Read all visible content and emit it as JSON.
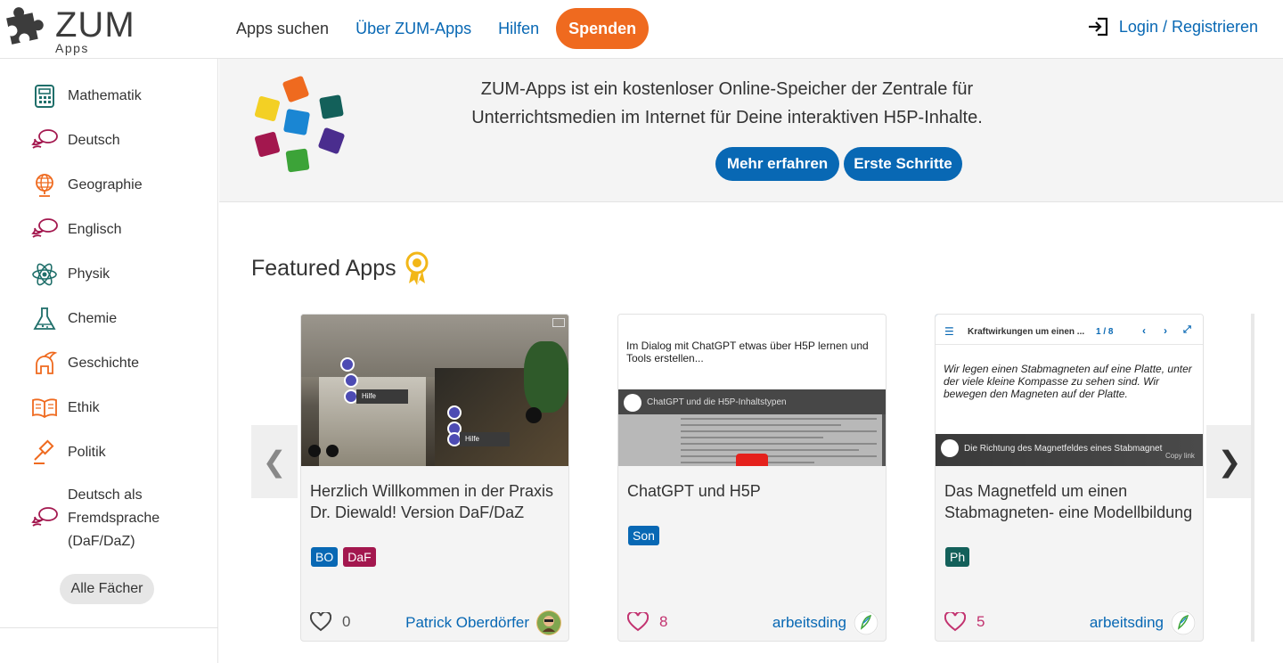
{
  "logo": {
    "name": "ZUM",
    "sub": "Apps"
  },
  "nav": {
    "items": [
      "Apps suchen",
      "Über ZUM-Apps",
      "Hilfen"
    ],
    "donate": "Spenden",
    "login": "Login / Registrieren"
  },
  "sidebar": {
    "subjects": [
      {
        "label": "Mathematik",
        "icon": "calculator-icon"
      },
      {
        "label": "Deutsch",
        "icon": "speech-bubble-icon"
      },
      {
        "label": "Geographie",
        "icon": "globe-icon"
      },
      {
        "label": "Englisch",
        "icon": "speech-bubble-icon"
      },
      {
        "label": "Physik",
        "icon": "atom-icon"
      },
      {
        "label": "Chemie",
        "icon": "flask-icon"
      },
      {
        "label": "Geschichte",
        "icon": "helmet-icon"
      },
      {
        "label": "Ethik",
        "icon": "book-icon"
      },
      {
        "label": "Politik",
        "icon": "gavel-icon"
      },
      {
        "label": "Deutsch als Fremdsprache (DaF/DaZ)",
        "icon": "speech-bubble-icon"
      }
    ],
    "all_button": "Alle Fächer"
  },
  "banner": {
    "text": "ZUM-Apps ist ein kostenloser Online-Speicher der Zentrale für Unterrichtsmedien im Internet für Deine interaktiven H5P-Inhalte.",
    "learn_more": "Mehr erfahren",
    "first_steps": "Erste Schritte"
  },
  "featured": {
    "title": "Featured Apps",
    "prev": "❮",
    "next": "❯",
    "cards": [
      {
        "title": "Herzlich Willkommen in der Praxis Dr. Diewald! Version DaF/DaZ",
        "tags": [
          {
            "label": "BO",
            "color": "#0868b4"
          },
          {
            "label": "DaF",
            "color": "#a3174e"
          }
        ],
        "likes": "0",
        "author": "Patrick Oberdörfer",
        "thumb_hotspot_label": "Hilfe"
      },
      {
        "title": "ChatGPT und H5P",
        "tags": [
          {
            "label": "Son",
            "color": "#0868b4"
          }
        ],
        "likes": "8",
        "author": "arbeitsding",
        "thumb_text": "Im Dialog mit ChatGPT etwas über H5P lernen und Tools erstellen...",
        "thumb_video_title": "ChatGPT und die H5P-Inhaltstypen"
      },
      {
        "title": "Das Magnetfeld um einen Stabmagneten- eine Modellbildung",
        "tags": [
          {
            "label": "Ph",
            "color": "#13605a"
          }
        ],
        "likes": "5",
        "author": "arbeitsding",
        "thumb_header": "Kraftwirkungen um einen ...",
        "thumb_page": "1 / 8",
        "thumb_text": "Wir legen einen Stabmagneten auf eine Platte, unter der viele kleine Kompasse zu sehen sind. Wir bewegen den Magneten auf der Platte.",
        "thumb_video_title": "Die Richtung des Magnetfeldes eines Stabmagnet",
        "thumb_copy": "Copy link"
      }
    ]
  },
  "colors": {
    "accent": "#0868b4",
    "donate": "#ef6a1f",
    "like_pink": "#c2326f"
  }
}
